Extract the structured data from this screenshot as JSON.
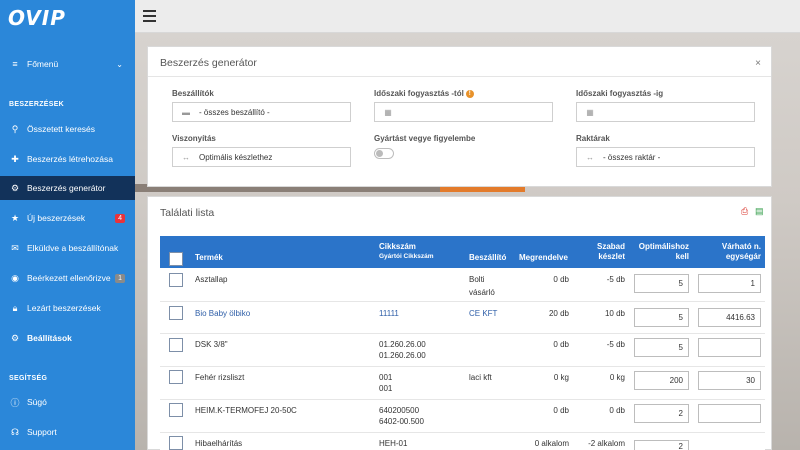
{
  "brand": {
    "logo_text": "OVIP"
  },
  "sidebar": {
    "menu": {
      "label": "Főmenü"
    },
    "section_purchase": "BESZERZÉSEK",
    "items": [
      {
        "label": "Összetett keresés",
        "icon": "search-icon"
      },
      {
        "label": "Beszerzés létrehozása",
        "icon": "plus-icon"
      },
      {
        "label": "Beszerzés generátor",
        "icon": "cogs-icon"
      },
      {
        "label": "Új beszerzések",
        "icon": "star-icon",
        "badge": "4"
      },
      {
        "label": "Elküldve a beszállítónak",
        "icon": "envelope-icon"
      },
      {
        "label": "Beérkezett ellenőrizve",
        "icon": "eye-icon",
        "badge": "1"
      },
      {
        "label": "Lezárt beszerzések",
        "icon": "lock-icon"
      },
      {
        "label": "Beállítások",
        "icon": "gear-icon"
      }
    ],
    "section_help": "SEGÍTSÉG",
    "help_items": [
      {
        "label": "Súgó",
        "icon": "info-icon"
      },
      {
        "label": "Support",
        "icon": "headset-icon"
      }
    ]
  },
  "generator": {
    "title": "Beszerzés generátor",
    "close": "×",
    "suppliers_label": "Beszállítók",
    "suppliers_value": "- összes beszállító -",
    "from_label": "Időszaki fogyasztás -tól",
    "to_label": "Időszaki fogyasztás -ig",
    "relation_label": "Viszonyítás",
    "relation_value": "Optimális készlethez",
    "production_label": "Gyártást vegye figyelembe",
    "warehouses_label": "Raktárak",
    "warehouses_value": "- összes raktár -"
  },
  "results": {
    "title": "Találati lista",
    "headers": {
      "product": "Termék",
      "sku": "Cikkszám",
      "sku_sub": "Gyártói Cikkszám",
      "supplier": "Beszállító",
      "ordered": "Megrendelve",
      "free_stock_1": "Szabad",
      "free_stock_2": "készlet",
      "optimal_1": "Optimálishoz",
      "optimal_2": "kell",
      "price_1": "Várható n.",
      "price_2": "egységár"
    },
    "rows": [
      {
        "product": "Asztallap",
        "sku": "",
        "sku2": "",
        "supplier": "Bolti",
        "supplier2": "vásárló",
        "ordered": "0 db",
        "free": "-5 db",
        "need": "5",
        "price": "1"
      },
      {
        "product": "Bio Baby ölbiko",
        "sku": "11111",
        "sku2": "",
        "supplier": "CE KFT",
        "supplier2": "",
        "ordered": "20 db",
        "free": "10 db",
        "need": "5",
        "price": "4416.63"
      },
      {
        "product": "DSK 3/8\"",
        "sku": "01.260.26.00",
        "sku2": "01.260.26.00",
        "supplier": "",
        "supplier2": "",
        "ordered": "0 db",
        "free": "-5 db",
        "need": "5",
        "price": ""
      },
      {
        "product": "Fehér rizsliszt",
        "sku": "001",
        "sku2": "001",
        "supplier": "laci kft",
        "supplier2": "",
        "ordered": "0 kg",
        "free": "0 kg",
        "need": "200",
        "price": "30"
      },
      {
        "product": "HEIM.K-TERMOFEJ 20-50C",
        "sku": "640200500",
        "sku2": "6402-00.500",
        "supplier": "",
        "supplier2": "",
        "ordered": "0 db",
        "free": "0 db",
        "need": "2",
        "price": ""
      },
      {
        "product": "Hibaelhárítás",
        "sku": "HEH-01",
        "sku2": "",
        "supplier": "",
        "supplier2": "",
        "ordered": "0 alkalom",
        "free": "-2 alkalom",
        "need": "2",
        "price": ""
      }
    ]
  },
  "colors": {
    "sidebar": "#2b87d9",
    "active": "#12325a",
    "table_header": "#2b74c9"
  }
}
